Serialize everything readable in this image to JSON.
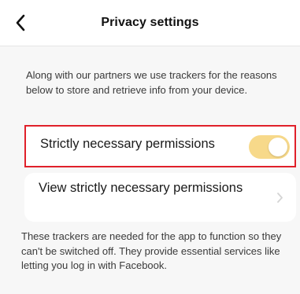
{
  "header": {
    "title": "Privacy settings",
    "back_icon": "chevron-left-icon"
  },
  "intro": {
    "text": "Along with our partners we use trackers for the reasons below to store and retrieve info from your device."
  },
  "strictly_necessary": {
    "label": "Strictly necessary permissions",
    "toggle_state": "on",
    "toggle_disabled": true
  },
  "view_permissions": {
    "label": "View strictly necessary permissions",
    "icon": "chevron-right-icon"
  },
  "description": {
    "text": "These trackers are needed for the app to function so they can't be switched off. They provide essential services like letting you log in with Facebook."
  },
  "colors": {
    "highlight_border": "#e0202a",
    "toggle_track": "#f7d98a",
    "background": "#f7f7f7",
    "card": "#ffffff"
  }
}
